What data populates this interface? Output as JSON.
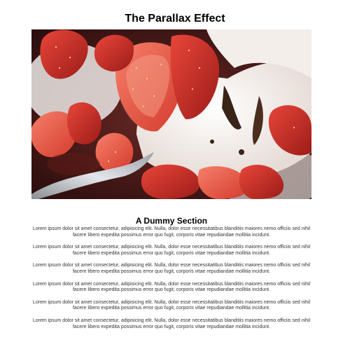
{
  "page": {
    "title": "The Parallax Effect"
  },
  "hero": {
    "image_label": "strawberries-and-ice-cream-photo"
  },
  "section": {
    "title": "A Dummy Section",
    "paragraphs": [
      "Lorem ipsum dolor sit amet consectetur, adipisicing elit. Nulla, dolor esse necessitatibus blanditiis maiores nemo officiis sed nihil facere libero expedita possimus error quo fugit, corporis vitae repudiandae mollitia incidunt.",
      "Lorem ipsum dolor sit amet consectetur, adipisicing elit. Nulla, dolor esse necessitatibus blanditiis maiores nemo officiis sed nihil facere libero expedita possimus error quo fugit, corporis vitae repudiandae mollitia incidunt.",
      "Lorem ipsum dolor sit amet consectetur, adipisicing elit. Nulla, dolor esse necessitatibus blanditiis maiores nemo officiis sed nihil facere libero expedita possimus error quo fugit, corporis vitae repudiandae mollitia incidunt.",
      "Lorem ipsum dolor sit amet consectetur, adipisicing elit. Nulla, dolor esse necessitatibus blanditiis maiores nemo officiis sed nihil facere libero expedita possimus error quo fugit, corporis vitae repudiandae mollitia incidunt.",
      "Lorem ipsum dolor sit amet consectetur, adipisicing elit. Nulla, dolor esse necessitatibus blanditiis maiores nemo officiis sed nihil facere libero expedita possimus error quo fugit, corporis vitae repudiandae mollitia incidunt.",
      "Lorem ipsum dolor sit amet consectetur, adipisicing elit. Nulla, dolor esse necessitatibus blanditiis maiores nemo officiis sed nihil facere libero expedita possimus error quo fugit, corporis vitae repudiandae mollitia incidunt."
    ]
  },
  "colors": {
    "background": "#ffffff",
    "title_text": "#000000",
    "body_text": "#333333",
    "strawberry": "#c8322a",
    "cream": "#f4eeea"
  }
}
